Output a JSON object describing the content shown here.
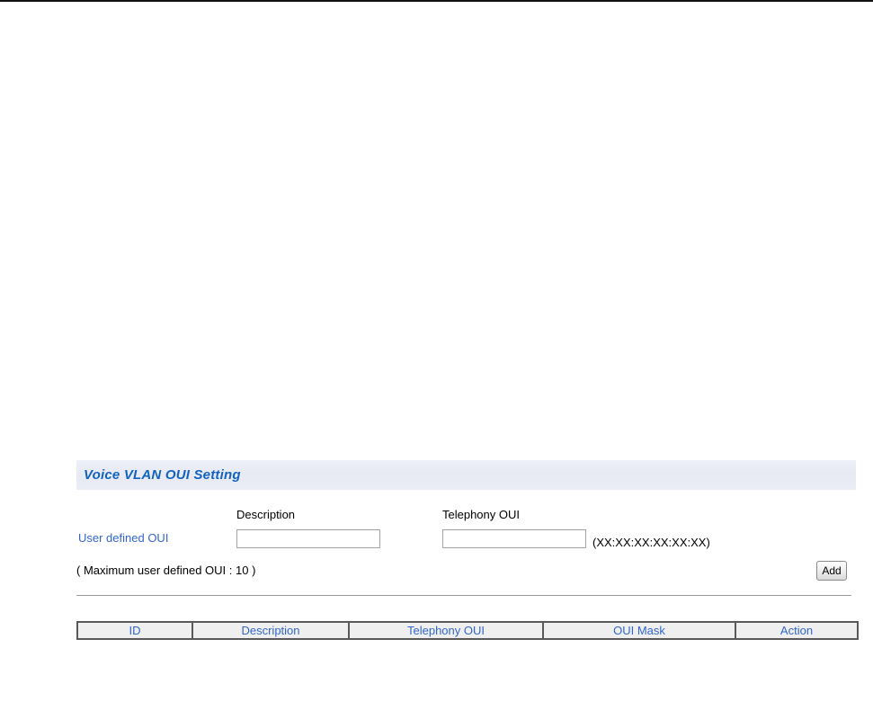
{
  "page": {
    "title": "Voice VLAN OUI Setting"
  },
  "form": {
    "labels": {
      "description": "Description",
      "telephony_oui": "Telephony OUI"
    },
    "row_label": "User defined OUI",
    "description_value": "",
    "telephony_value": "",
    "format_hint": "(XX:XX:XX:XX:XX:XX)",
    "max_note": "( Maximum user defined OUI : 10 )",
    "add_button_label": "Add"
  },
  "table": {
    "headers": [
      "ID",
      "Description",
      "Telephony OUI",
      "OUI Mask",
      "Action"
    ],
    "rows": []
  },
  "colors": {
    "title_text": "#1263c0",
    "title_bar_bg": "#e9ebf4",
    "label_blue": "#3366cc",
    "table_header_text": "#3366cc",
    "table_header_bg": "#efefef",
    "table_border": "#595959",
    "top_line": "#111111"
  }
}
